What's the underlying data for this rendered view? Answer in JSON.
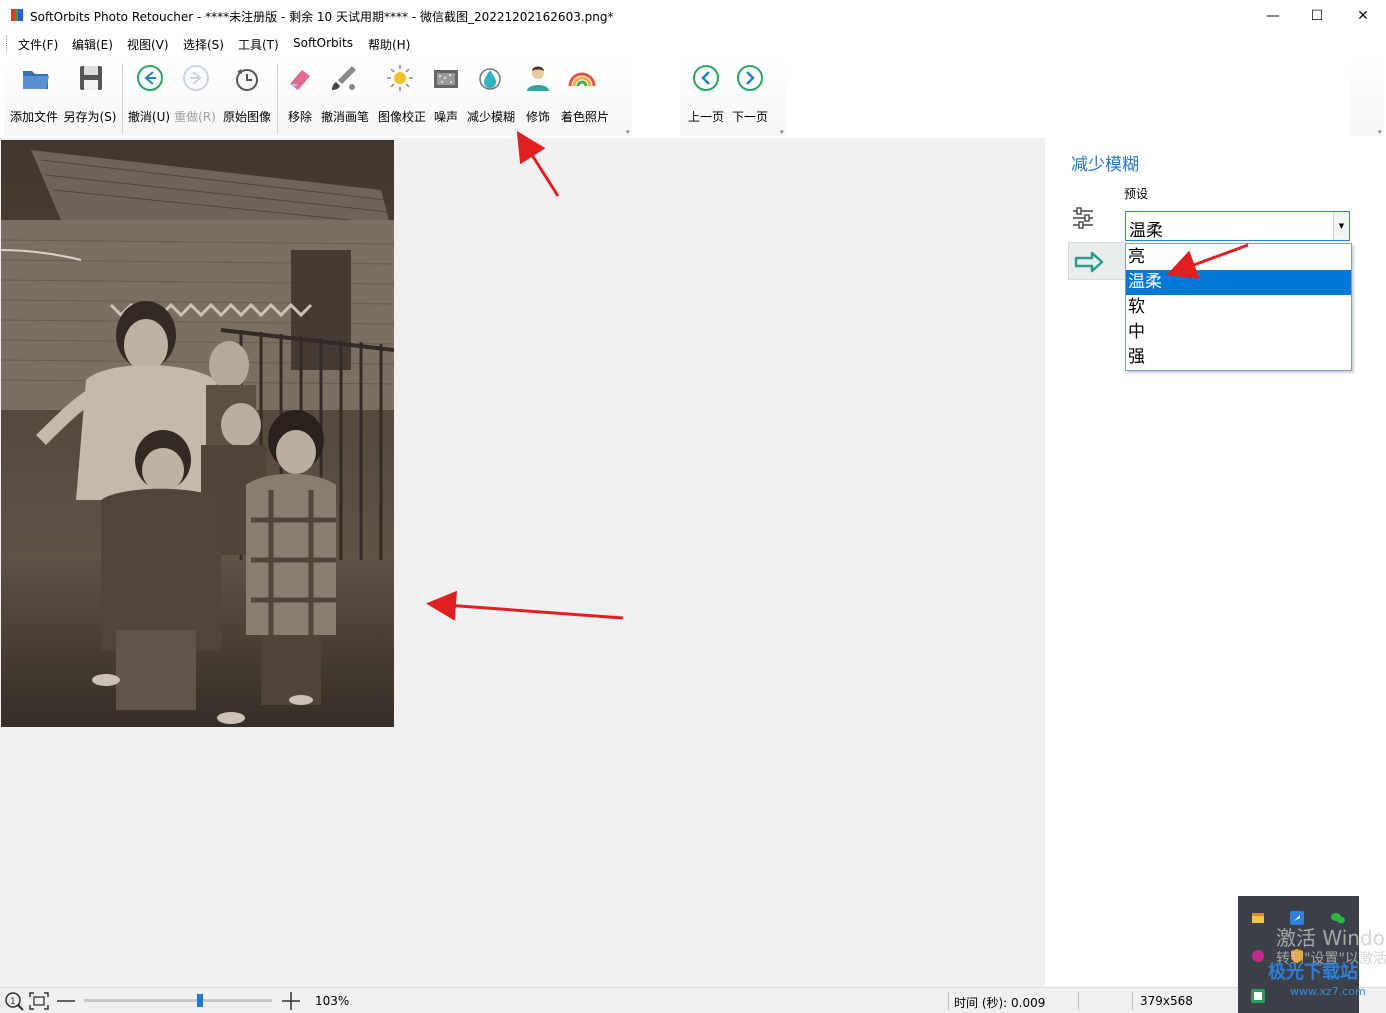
{
  "window": {
    "title": "SoftOrbits Photo Retoucher - ****未注册版 - 剩余 10 天试用期**** - 微信截图_20221202162603.png*",
    "controls": [
      "—",
      "☐",
      "✕"
    ]
  },
  "menu": {
    "items": [
      "文件(F)",
      "编辑(E)",
      "视图(V)",
      "选择(S)",
      "工具(T)",
      "SoftOrbits",
      "帮助(H)"
    ]
  },
  "toolbar": {
    "add_file": "添加文件",
    "save_as": "另存为(S)",
    "undo": "撤消(U)",
    "redo": "重做(R)",
    "original": "原始图像",
    "remove": "移除",
    "undo_brush": "撤消画笔",
    "image_correction": "图像校正",
    "noise": "噪声",
    "reduce_blur": "减少模糊",
    "retouch": "修饰",
    "colorize": "着色照片",
    "prev_page": "上一页",
    "next_page": "下一页",
    "more": "▾"
  },
  "panel": {
    "title": "减少模糊",
    "preset_label": "预设",
    "preset_value": "温柔",
    "options": [
      "亮",
      "温柔",
      "软",
      "中",
      "强"
    ],
    "selected_index": 1
  },
  "statusbar": {
    "zoom_level": "103%",
    "zoom_fraction": 0.62,
    "time": "时间 (秒): 0.009",
    "image_size": "379x568"
  },
  "overlay": {
    "watermark_line1": "激活 Windo",
    "watermark_line2": "转到\"设置\"以激活",
    "site_logo": "极光下载站",
    "site_url": "www.xz7.com"
  },
  "colors": {
    "accent": "#2b74c6",
    "selection": "#0078d7",
    "arrow": "#e02020"
  }
}
